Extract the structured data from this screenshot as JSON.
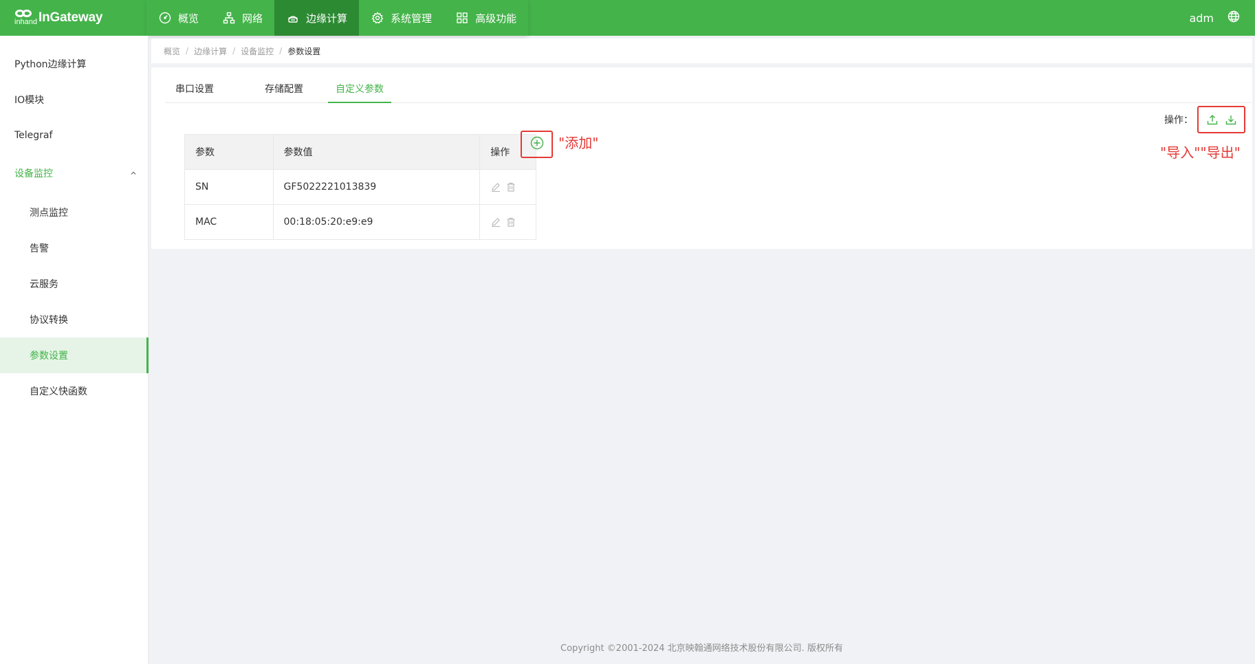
{
  "brand": {
    "logo_sub": "inhand",
    "name": "InGateway"
  },
  "nav": [
    {
      "label": "概览",
      "icon": "dashboard-icon"
    },
    {
      "label": "网络",
      "icon": "network-icon"
    },
    {
      "label": "边缘计算",
      "icon": "edge-computing-icon",
      "active": true
    },
    {
      "label": "系统管理",
      "icon": "gear-icon"
    },
    {
      "label": "高级功能",
      "icon": "grid-icon"
    }
  ],
  "user": {
    "name": "adm",
    "lang_icon": "globe-icon"
  },
  "sidebar": {
    "items": [
      {
        "label": "Python边缘计算"
      },
      {
        "label": "IO模块"
      },
      {
        "label": "Telegraf"
      },
      {
        "label": "设备监控",
        "expanded": true
      },
      {
        "label": "测点监控"
      },
      {
        "label": "告警"
      },
      {
        "label": "云服务"
      },
      {
        "label": "协议转换"
      },
      {
        "label": "参数设置",
        "selected": true
      },
      {
        "label": "自定义快函数"
      }
    ]
  },
  "breadcrumb": [
    "概览",
    "边缘计算",
    "设备监控",
    "参数设置"
  ],
  "tabs": [
    {
      "label": "串口设置"
    },
    {
      "label": "存储配置"
    },
    {
      "label": "自定义参数",
      "active": true
    }
  ],
  "ops": {
    "label": "操作：",
    "import_icon": "upload-icon",
    "export_icon": "download-icon"
  },
  "table": {
    "headers": [
      "参数",
      "参数值",
      "操作"
    ],
    "rows": [
      {
        "param": "SN",
        "value": "GF5022221013839"
      },
      {
        "param": "MAC",
        "value": "00:18:05:20:e9:e9"
      }
    ]
  },
  "annotations": {
    "add": "\"添加\"",
    "import_export": "\"导入\"\"导出\""
  },
  "footer": "Copyright ©2001-2024 北京映翰通网络技术股份有限公司. 版权所有",
  "colors": {
    "primary": "#44b34a",
    "primary_dark": "#2c8a33",
    "annotation": "#e53935"
  }
}
